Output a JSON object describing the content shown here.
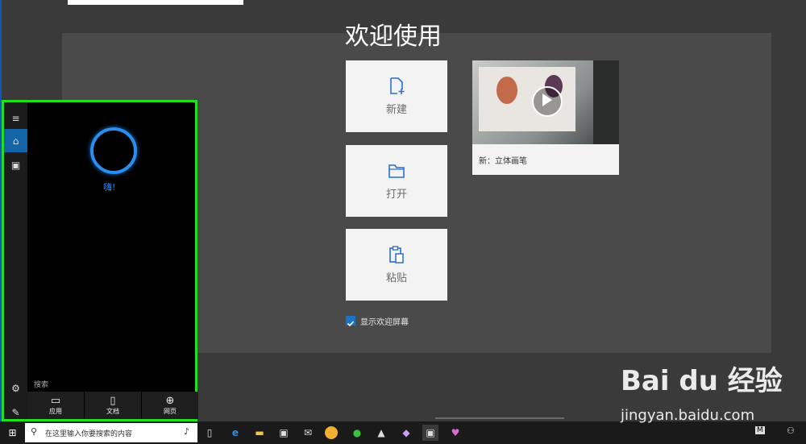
{
  "app": {
    "welcome_title": "欢迎使用"
  },
  "tiles": {
    "new_label": "新建",
    "open_label": "打开",
    "paste_label": "粘贴"
  },
  "video": {
    "caption": "新：立体画笔"
  },
  "welcome_checkbox": {
    "label": "显示欢迎屏幕",
    "checked": true
  },
  "cortana": {
    "greeting": "嗨!",
    "search_label": "搜索",
    "filters": [
      {
        "label": "应用",
        "icon": "app-icon"
      },
      {
        "label": "文档",
        "icon": "document-icon"
      },
      {
        "label": "网页",
        "icon": "globe-icon"
      }
    ]
  },
  "taskbar": {
    "search_placeholder": "在这里输入你要搜索的内容",
    "tray_badge": "M"
  },
  "watermark": {
    "logo": "Bai du 经验",
    "url": "jingyan.baidu.com"
  },
  "colors": {
    "accent": "#1a73c8",
    "highlight_border": "#22dd22",
    "cortana_ring": "#2a8ef0"
  }
}
